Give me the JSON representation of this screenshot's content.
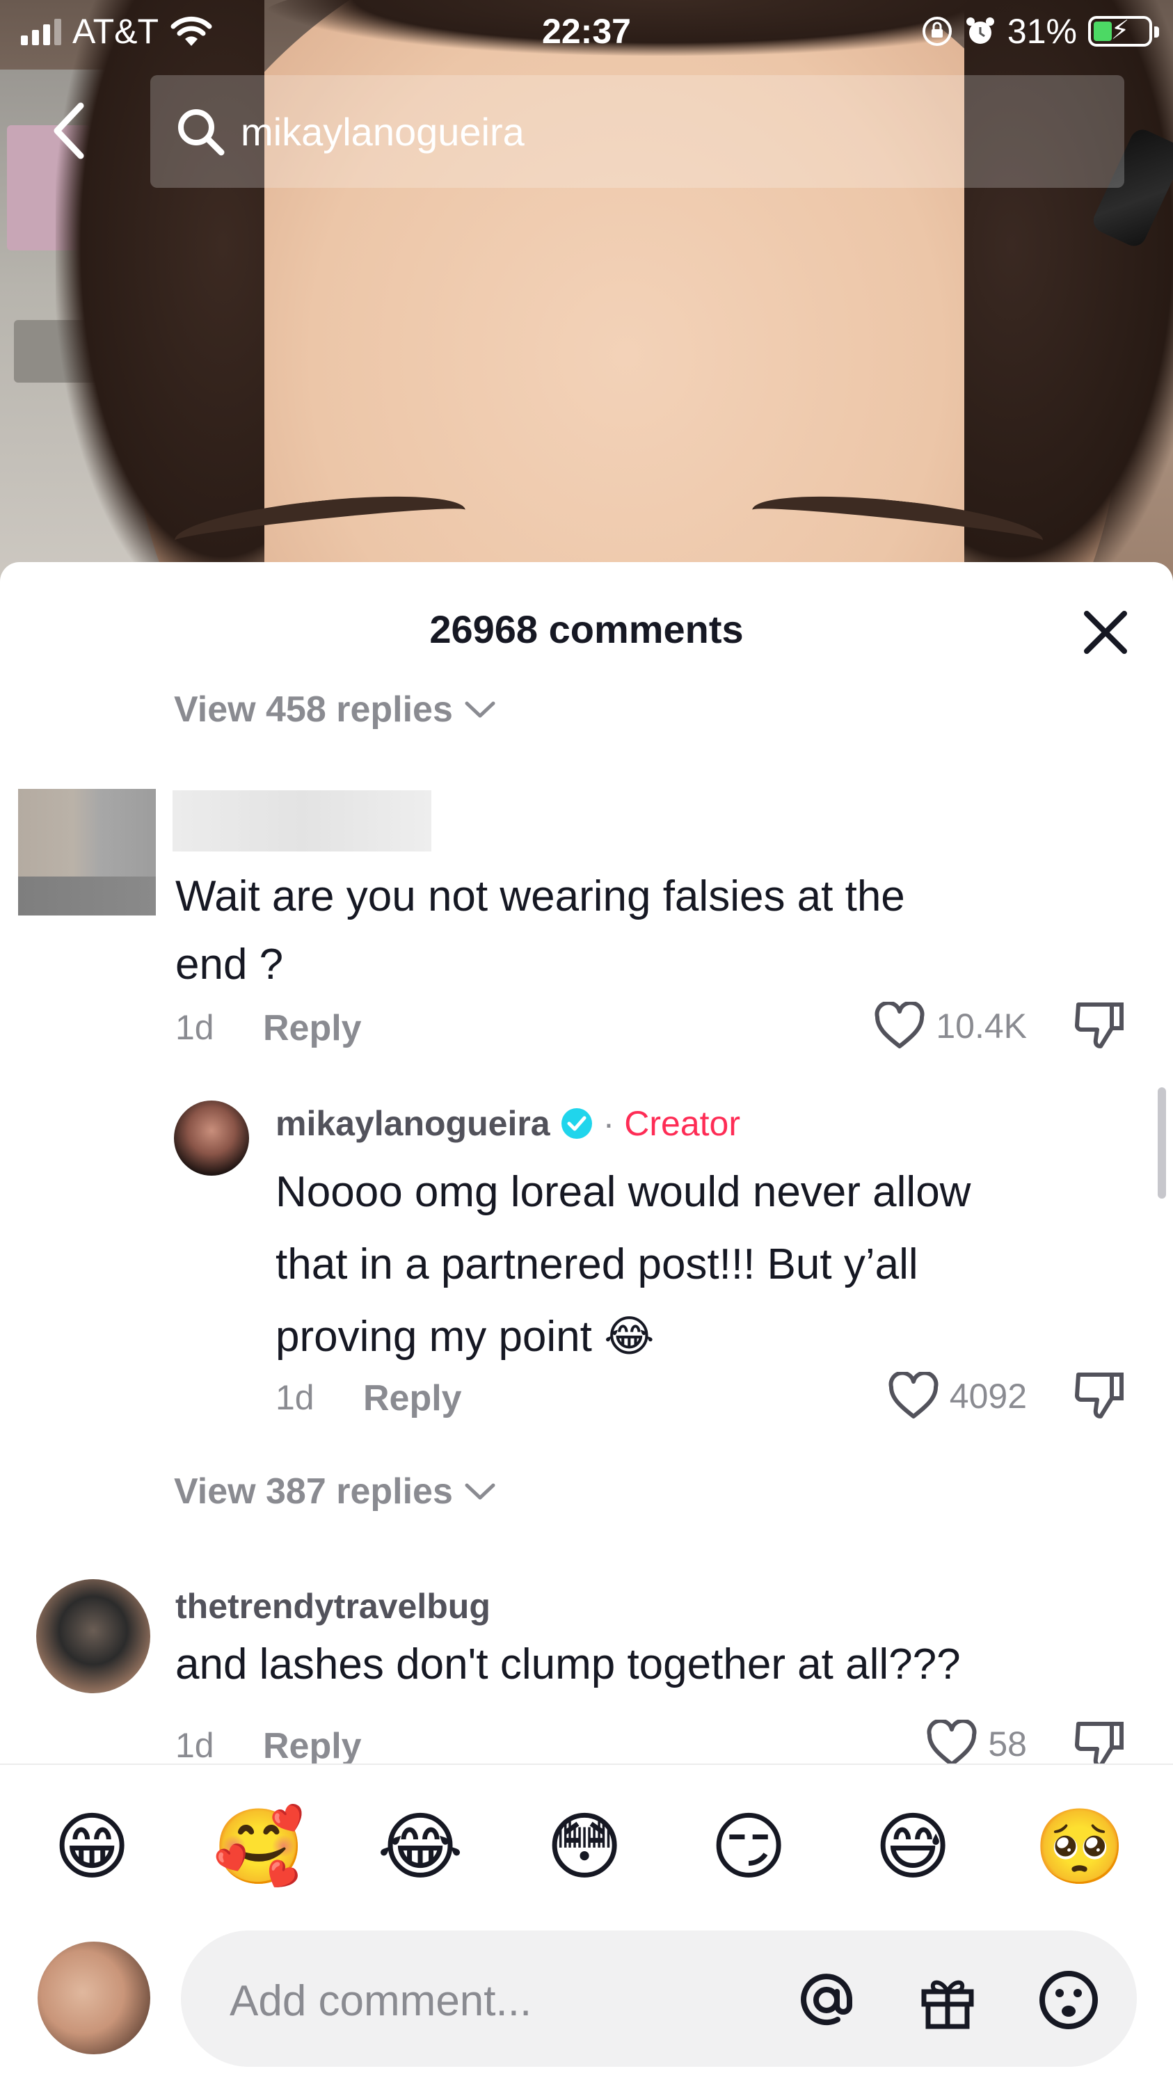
{
  "status_bar": {
    "carrier": "AT&T",
    "time": "22:37",
    "battery_percent": "31%",
    "icons": [
      "signal-icon",
      "wifi-icon",
      "rotation-lock-icon",
      "alarm-icon",
      "battery-charging-icon"
    ]
  },
  "search": {
    "query": "mikaylanogueira"
  },
  "comments": {
    "header_title": "26968 comments",
    "top_view_replies": "View 458 replies",
    "first_comment": {
      "text_line1": "Wait are you not wearing falsies at the",
      "text_line2": "end ?",
      "time": "1d",
      "reply_label": "Reply",
      "likes": "10.4K"
    },
    "creator_reply": {
      "username": "mikaylanogueira",
      "separator": "·",
      "creator_label": "Creator",
      "text_line1": "Noooo omg loreal would never allow",
      "text_line2": "that in a partnered post!!! But y’all",
      "text_line3": "proving my point",
      "text_emoji": "😂",
      "time": "1d",
      "reply_label": "Reply",
      "likes": "4092"
    },
    "middle_view_replies": "View 387 replies",
    "second_comment": {
      "username": "thetrendytravelbug",
      "text": "and lashes don't clump together at all???",
      "time": "1d",
      "reply_label": "Reply",
      "likes": "58"
    }
  },
  "emoji_bar": [
    "😁",
    "🥰",
    "😂",
    "😳",
    "😏",
    "😅",
    "🥺"
  ],
  "input": {
    "placeholder": "Add comment..."
  },
  "colors": {
    "creator_accent": "#fe2c55",
    "verified_blue": "#20d5ec",
    "muted_text": "#8a8b91"
  }
}
